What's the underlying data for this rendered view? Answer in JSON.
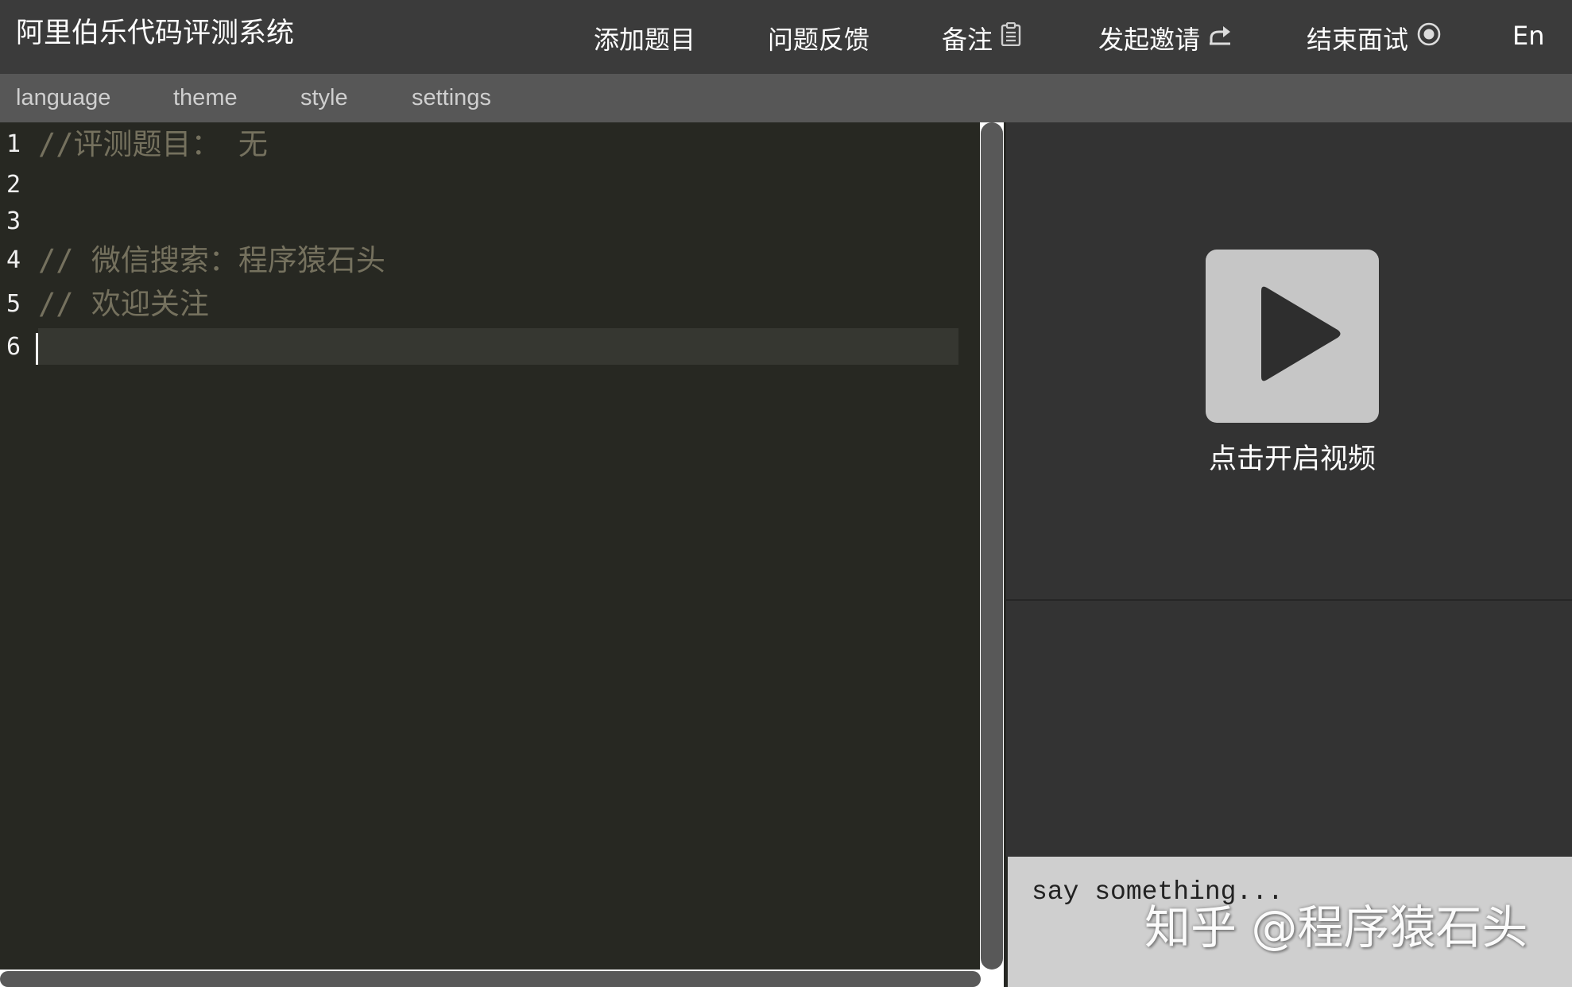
{
  "header": {
    "title": "阿里伯乐代码评测系统",
    "nav": {
      "add_question": "添加题目",
      "feedback": "问题反馈",
      "notes": "备注",
      "invite": "发起邀请",
      "end_interview": "结束面试",
      "language_toggle": "En"
    },
    "icons": {
      "notes": "clipboard-icon",
      "invite": "share-arrow-icon",
      "end_interview": "record-stop-icon"
    }
  },
  "menu": {
    "language": "language",
    "theme": "theme",
    "style": "style",
    "settings": "settings"
  },
  "editor": {
    "lines": [
      {
        "number": "1",
        "code": "//评测题目： 无"
      },
      {
        "number": "2",
        "code": ""
      },
      {
        "number": "3",
        "code": ""
      },
      {
        "number": "4",
        "code": "// 微信搜索：程序猿石头"
      },
      {
        "number": "5",
        "code": "// 欢迎关注"
      },
      {
        "number": "6",
        "code": ""
      }
    ],
    "active_line": 6,
    "colors": {
      "background": "#272822",
      "comment": "#75715e",
      "gutter_text": "#f0f0f0",
      "active_line": "#363731"
    }
  },
  "video": {
    "label": "点击开启视频",
    "icon": "play-icon"
  },
  "chat": {
    "placeholder": "say something..."
  },
  "watermark": "知乎 @程序猿石头"
}
